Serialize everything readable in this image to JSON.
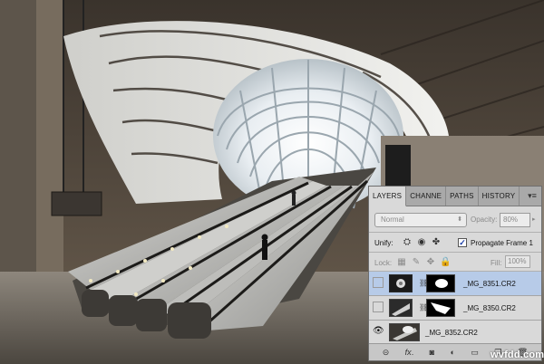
{
  "panel": {
    "tabs": [
      "LAYERS",
      "CHANNE",
      "PATHS",
      "HISTORY"
    ],
    "blend_mode": "Normal",
    "opacity_label": "Opacity:",
    "opacity_value": "80%",
    "unify_label": "Unify:",
    "propagate_label": "Propagate Frame 1",
    "propagate_checked": true,
    "lock_label": "Lock:",
    "fill_label": "Fill:",
    "fill_value": "100%",
    "layers": [
      {
        "name": "_MG_8351.CR2",
        "selected": true,
        "visible": false,
        "has_mask": true
      },
      {
        "name": "_MG_8350.CR2",
        "selected": false,
        "visible": false,
        "has_mask": true
      },
      {
        "name": "_MG_8352.CR2",
        "selected": false,
        "visible": true,
        "has_mask": false
      }
    ],
    "footer_icons": [
      "link-icon",
      "fx-icon",
      "mask-icon",
      "adjustment-icon",
      "folder-icon",
      "new-layer-icon",
      "trash-icon"
    ]
  },
  "watermark": "wvfdd.com"
}
